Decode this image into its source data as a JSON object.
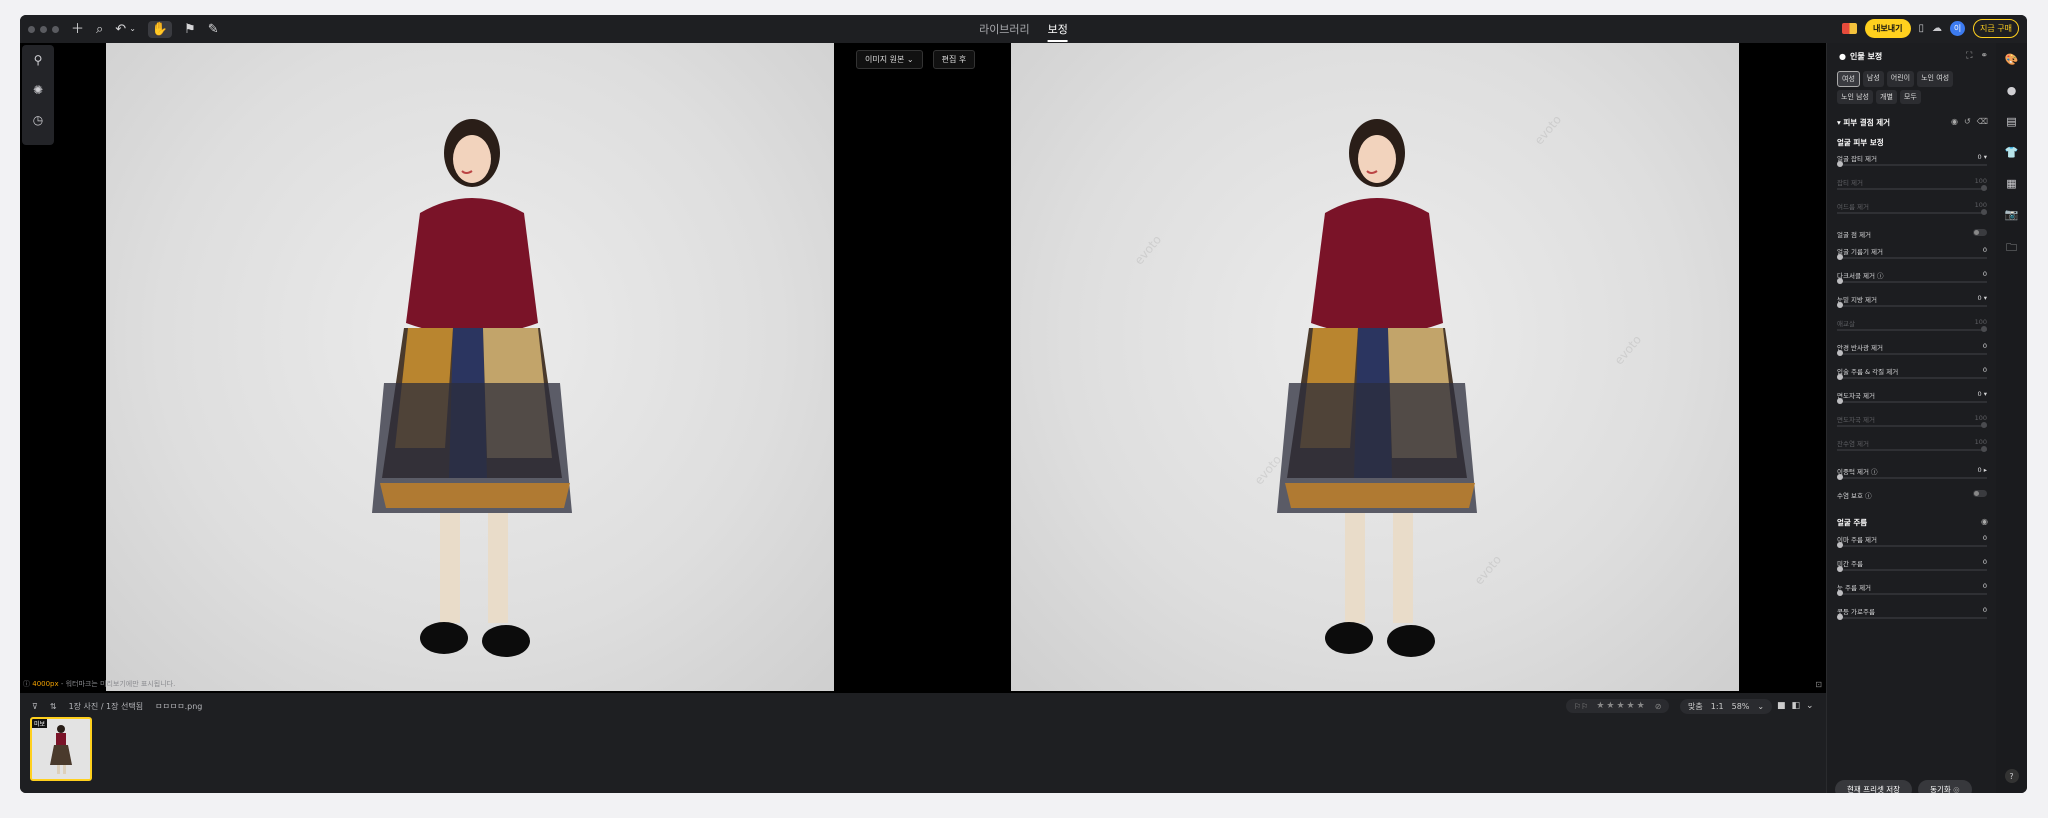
{
  "topbar": {
    "tabs": [
      {
        "label": "라이브러리"
      },
      {
        "label": "보정"
      }
    ],
    "export_label": "내보내기",
    "avatar_letter": "이",
    "buy_label": "지금 구매"
  },
  "canvas": {
    "compare": {
      "before_label": "이미지 원본",
      "after_label": "편집 후"
    },
    "info": {
      "size": "4000px",
      "text": " - 워터마크는 미리보기에만 표시됩니다."
    },
    "watermark": "evoto"
  },
  "filmstrip": {
    "count": "1장 사진 / 1장 선택됨",
    "filename": "ㅁㅁㅁㅁ.png",
    "thumb_badge": "미보"
  },
  "ratingbar": {
    "stars": "★★★★★"
  },
  "zoombar": {
    "fit": "맞춤",
    "one": "1:1",
    "zoom": "58%"
  },
  "panel": {
    "title": "인물 보정",
    "chips": [
      "여성",
      "남성",
      "어린이",
      "노인 여성",
      "노인 남성",
      "개별",
      "모두"
    ],
    "selected_chip": "여성",
    "section1": "피부 결점 제거",
    "sub1": "얼굴 피부 보정",
    "rows1": [
      {
        "label": "얼굴 잡티 제거",
        "value": "0",
        "dim": false
      },
      {
        "label": "잡티 제거",
        "value": "100",
        "dim": true
      },
      {
        "label": "여드름 제거",
        "value": "100",
        "dim": true
      }
    ],
    "toggle_row": {
      "label": "얼굴 점 제거"
    },
    "rows2": [
      {
        "label": "얼굴 기름기 제거",
        "value": "0",
        "dim": false
      },
      {
        "label": "다크서클 제거",
        "value": "0",
        "dim": false
      },
      {
        "label": "눈밑 지방 제거",
        "value": "0",
        "dim": false
      },
      {
        "label": "애교살",
        "value": "100",
        "dim": true
      },
      {
        "label": "안경 반사광 제거",
        "value": "0",
        "dim": false
      },
      {
        "label": "입술 주름 & 각질 제거",
        "value": "0",
        "dim": false
      },
      {
        "label": "면도자국 제거",
        "value": "0",
        "dim": false
      },
      {
        "label": "면도자국 제거",
        "value": "100",
        "dim": true
      },
      {
        "label": "잔수염 제거",
        "value": "100",
        "dim": true
      },
      {
        "label": "이중턱 제거",
        "value": "0",
        "dim": false
      }
    ],
    "beard_row": {
      "label": "수염 보호"
    },
    "section2": "얼굴 주름",
    "rows3": [
      {
        "label": "이마 주름 제거",
        "value": "0",
        "dim": false
      },
      {
        "label": "미간 주름",
        "value": "0",
        "dim": false
      },
      {
        "label": "눈 주름 제거",
        "value": "0",
        "dim": false
      },
      {
        "label": "콧등 가로주름",
        "value": "0",
        "dim": false
      }
    ],
    "save_preset": "현재 프리셋 저장",
    "sync": "동기화"
  }
}
